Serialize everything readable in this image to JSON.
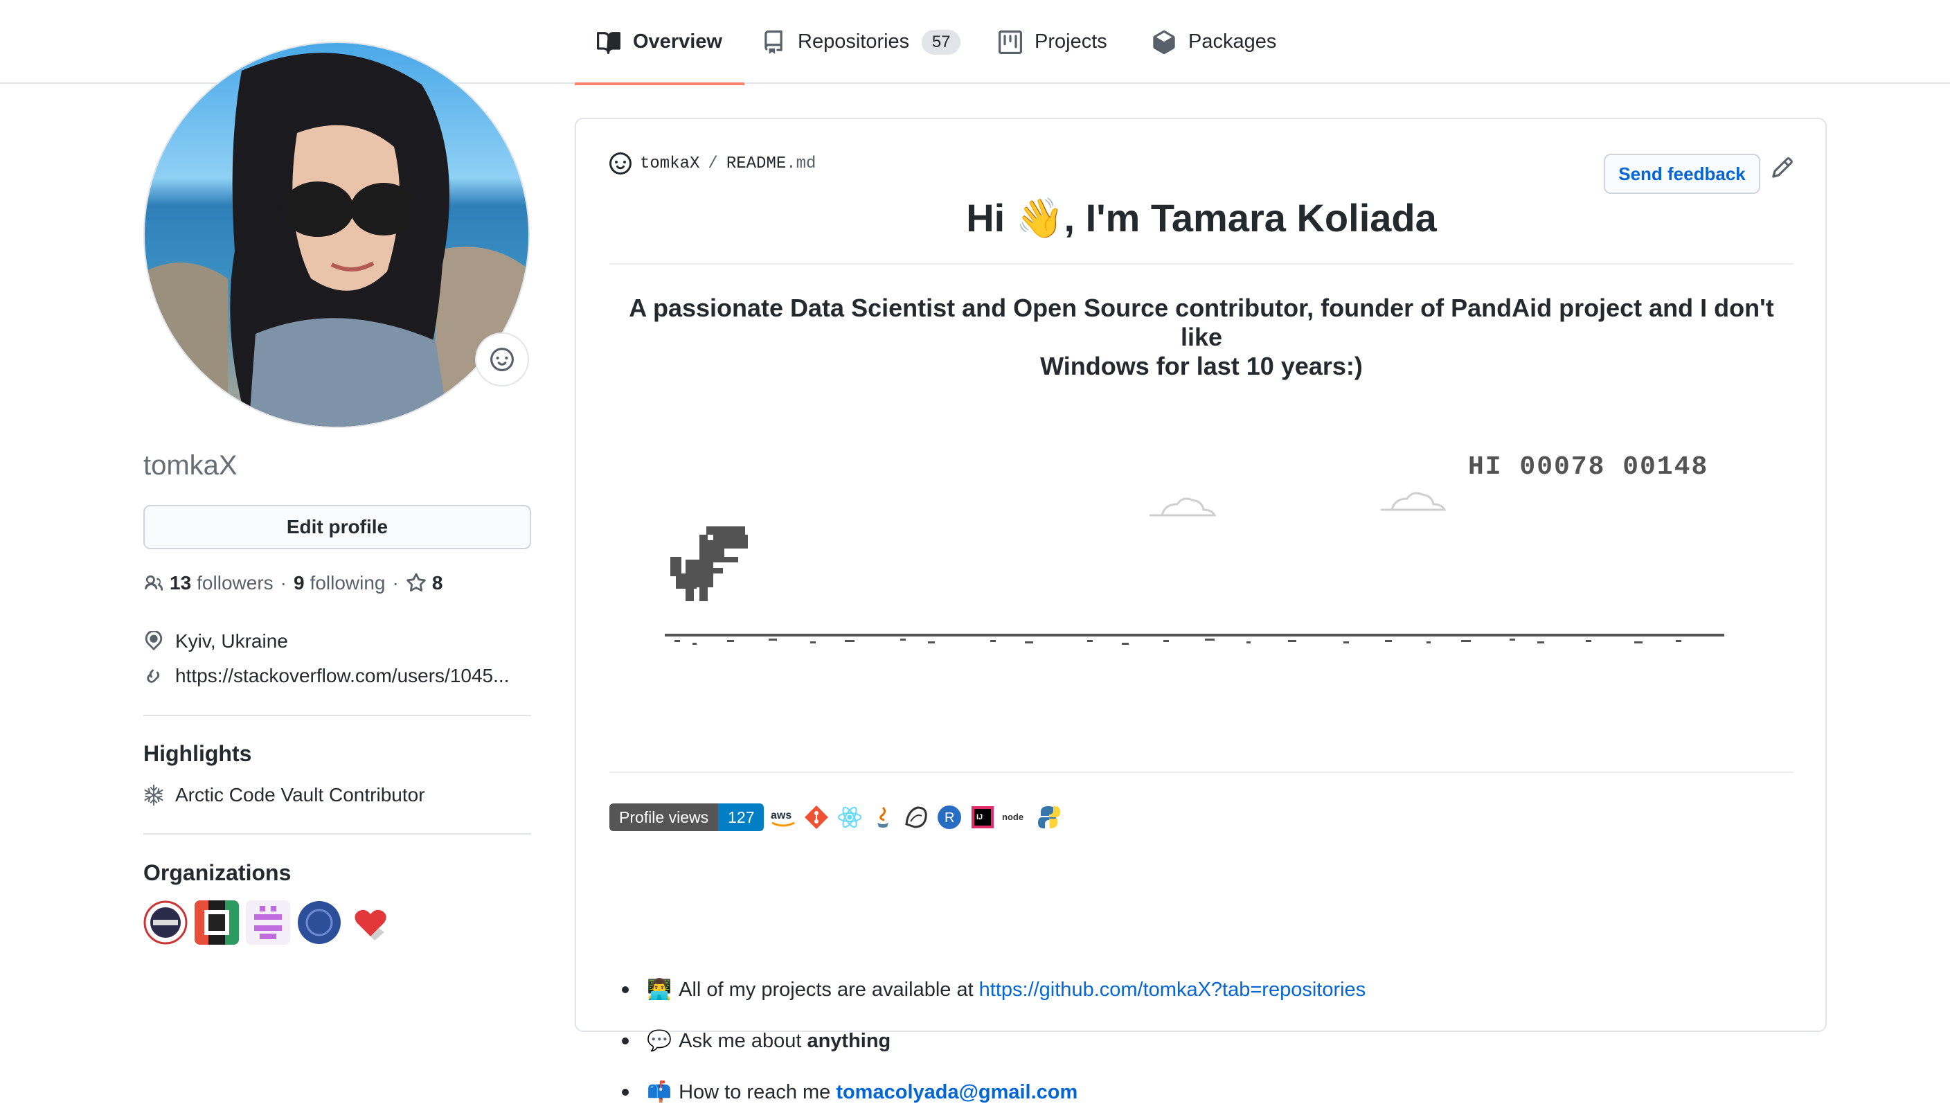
{
  "tabs": [
    {
      "label": "Overview",
      "icon": "book-icon",
      "active": true
    },
    {
      "label": "Repositories",
      "icon": "repo-icon",
      "count": "57"
    },
    {
      "label": "Projects",
      "icon": "project-icon"
    },
    {
      "label": "Packages",
      "icon": "package-icon"
    }
  ],
  "profile": {
    "username": "tomkaX",
    "edit_label": "Edit profile",
    "followers_count": "13",
    "followers_label": "followers",
    "dot": "·",
    "following_count": "9",
    "following_label": "following",
    "stars_count": "8",
    "location": "Kyiv, Ukraine",
    "website": "https://stackoverflow.com/users/1045..."
  },
  "highlights": {
    "title": "Highlights",
    "item": "Arctic Code Vault Contributor"
  },
  "organizations": {
    "title": "Organizations"
  },
  "readme": {
    "user": "tomkaX",
    "sep": "/",
    "file": "README",
    "ext": ".md",
    "feedback_label": "Send feedback",
    "title": "Hi 👋, I'm Tamara Koliada",
    "tagline_1": "A passionate Data Scientist and Open Source contributor, founder of PandAid project and I don't like",
    "tagline_2": "Windows for last 10 years:)",
    "game_score": "HI 00078  00148",
    "profile_views_label": "Profile views",
    "profile_views": "127",
    "bullets": {
      "b1_emoji": "👨‍💻",
      "b1_text": "All of my projects are available at",
      "b1_link": "https://github.com/tomkaX?tab=repositories",
      "b2_emoji": "💬",
      "b2_text": "Ask me about",
      "b2_bold": "anything",
      "b3_emoji": "📫",
      "b3_text": "How to reach me",
      "b3_link": "tomacolyada@gmail.com"
    }
  },
  "colors": {
    "accent_tab": "#f9826c",
    "link": "#0366d6",
    "badge_left": "#555555",
    "badge_right": "#007ec6"
  }
}
